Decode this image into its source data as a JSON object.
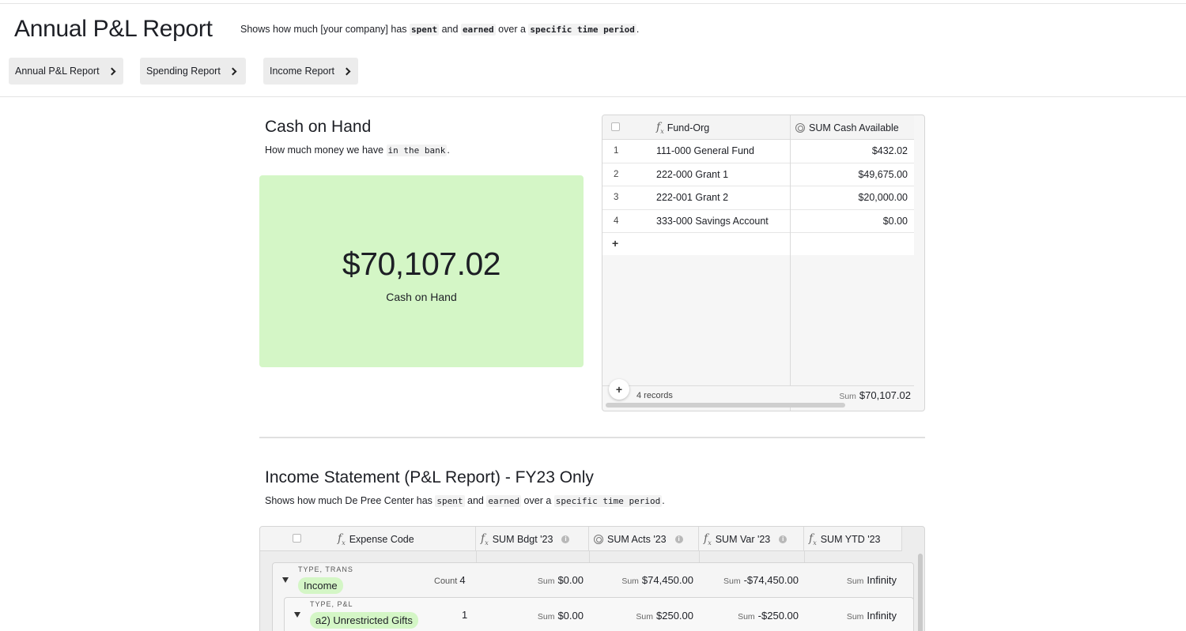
{
  "header": {
    "title": "Annual P&L Report",
    "desc_1": "Shows how much [your company] has ",
    "desc_spent": "spent",
    "desc_2": " and ",
    "desc_earned": "earned",
    "desc_3": " over a ",
    "desc_period": "specific time period",
    "desc_4": "."
  },
  "nav": {
    "buttons": [
      {
        "label": "Annual P&L Report"
      },
      {
        "label": "Spending Report"
      },
      {
        "label": "Income Report"
      }
    ]
  },
  "cash_section": {
    "title": "Cash on Hand",
    "desc_1": "How much money we have ",
    "desc_code": "in the bank",
    "desc_2": ".",
    "big_value": "$70,107.02",
    "big_label": "Cash on Hand"
  },
  "fund_grid": {
    "col1_header": "Fund-Org",
    "col2_header": "SUM Cash Available",
    "rows": [
      {
        "num": "1",
        "name": "111-000 General Fund",
        "value": "$432.02"
      },
      {
        "num": "2",
        "name": "222-000 Grant 1",
        "value": "$49,675.00"
      },
      {
        "num": "3",
        "name": "222-001 Grant 2",
        "value": "$20,000.00"
      },
      {
        "num": "4",
        "name": "333-000 Savings Account",
        "value": "$0.00"
      }
    ],
    "add_row": "+",
    "add_button": "+",
    "records_label": "4 records",
    "sum_prefix": "Sum",
    "sum_value": "$70,107.02"
  },
  "income_section": {
    "title": "Income Statement (P&L Report) - FY23 Only",
    "desc_1": "Shows how much De Pree Center has ",
    "desc_spent": "spent",
    "desc_2": " and ",
    "desc_earned": "earned",
    "desc_3": " over a ",
    "desc_period": "specific time period",
    "desc_4": "."
  },
  "pl_grid": {
    "headers": [
      "Expense Code",
      "SUM Bdgt '23",
      "SUM Acts '23",
      "SUM Var '23",
      "SUM YTD '23"
    ],
    "groups": [
      {
        "group_label": "TYPE, TRANS",
        "name": "Income",
        "count_label": "Count",
        "count": "4",
        "sum_prefix": "Sum",
        "sums": [
          "$0.00",
          "$74,450.00",
          "-$74,450.00",
          "Infinity"
        ]
      },
      {
        "group_label": "TYPE, P&L",
        "name": "a2) Unrestricted Gifts",
        "count": "1",
        "sum_prefix": "Sum",
        "sums": [
          "$0.00",
          "$250.00",
          "-$250.00",
          "Infinity"
        ]
      }
    ]
  }
}
